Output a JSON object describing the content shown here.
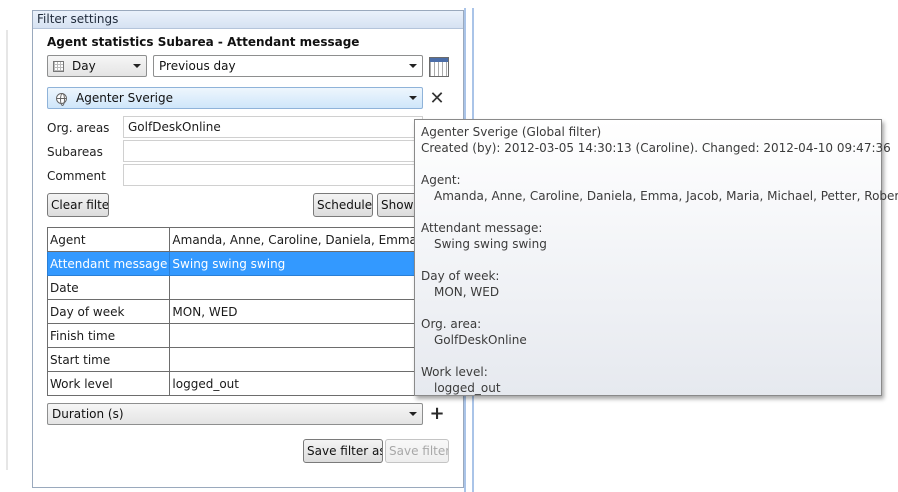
{
  "panel": {
    "title": "Filter settings",
    "heading": "Agent statistics Subarea - Attendant message"
  },
  "period": {
    "unit": "Day",
    "range": "Previous day"
  },
  "global_filter": {
    "selected": "Agenter Sverige"
  },
  "fields": {
    "org_areas_label": "Org. areas",
    "org_areas_value": "GolfDeskOnline",
    "subareas_label": "Subareas",
    "subareas_value": "",
    "comment_label": "Comment",
    "comment_value": ""
  },
  "buttons": {
    "clear_filter": "Clear filter",
    "schedule": "Schedule",
    "show": "Show r",
    "save_filter_as": "Save filter as...",
    "save_filter": "Save filter..."
  },
  "grid": {
    "rows": [
      {
        "name": "Agent",
        "value": "Amanda, Anne, Caroline, Daniela, Emma, Jacob, ..."
      },
      {
        "name": "Attendant message",
        "value": "Swing swing swing"
      },
      {
        "name": "Date",
        "value": ""
      },
      {
        "name": "Day of week",
        "value": "MON, WED"
      },
      {
        "name": "Finish time",
        "value": ""
      },
      {
        "name": "Start time",
        "value": ""
      },
      {
        "name": "Work level",
        "value": "logged_out"
      }
    ],
    "selected_row": 1
  },
  "measure": {
    "selected": "Duration (s)"
  },
  "tooltip": {
    "title": "Agenter Sverige (Global filter)",
    "created": "Created (by): 2012-03-05 14:30:13 (Caroline). Changed: 2012-04-10 09:47:36",
    "agent_label": "Agent:",
    "agent_value": "Amanda, Anne, Caroline, Daniela, Emma, Jacob, Maria, Michael, Petter, Robert, Wille",
    "attendant_label": "Attendant message:",
    "attendant_value": "Swing swing swing",
    "dow_label": "Day of week:",
    "dow_value": "MON, WED",
    "org_label": "Org. area:",
    "org_value": "GolfDeskOnline",
    "work_label": "Work level:",
    "work_value": "logged_out"
  },
  "colors": {
    "selection": "#3399ff",
    "splitter": "#aac4e8",
    "titlebar": "#d6e2f2"
  },
  "icons": {
    "calendar": "calendar-icon",
    "globe": "globe-icon",
    "close": "close-icon",
    "add": "plus-icon"
  }
}
